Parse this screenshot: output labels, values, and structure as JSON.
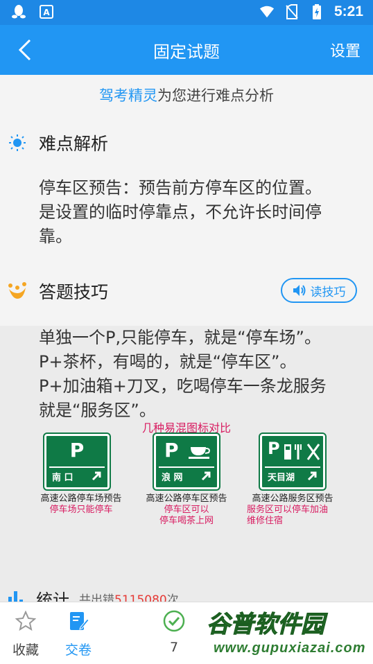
{
  "status_bar": {
    "time": "5:21"
  },
  "header": {
    "title": "固定试题",
    "settings_label": "设置"
  },
  "analysis_line": {
    "brand": "驾考精灵",
    "suffix": "为您进行难点分析"
  },
  "difficulty": {
    "title": "难点解析",
    "body": "停车区预告：预告前方停车区的位置。是设置的临时停靠点，不允许长时间停靠。"
  },
  "tips": {
    "title": "答题技巧",
    "read_button": "读技巧",
    "body": "单独一个P,只能停车，就是“停车场”。P+茶杯，有喝的，就是“停车区”。P+加油箱+刀叉，吃喝停车一条龙服务就是“服务区”。"
  },
  "signs": {
    "title": "几种易混图标对比",
    "items": [
      {
        "symbol": "P",
        "place": "南 口",
        "caption": "高速公路停车场预告",
        "note": "停车场只能停车"
      },
      {
        "symbol": "P",
        "place": "浪 网",
        "caption": "高速公路停车区预告",
        "note": "停车区可以\n停车喝茶上网"
      },
      {
        "symbol": "P",
        "place": "天目湖",
        "caption": "高速公路服务区预告",
        "note": "服务区可以停车加油\n维修住宿"
      }
    ]
  },
  "stats": {
    "title": "统计",
    "prefix": "共出错",
    "count": "5115080",
    "suffix": "次"
  },
  "bottom_tabs": [
    {
      "label": "收藏",
      "icon": "star-icon"
    },
    {
      "label": "交卷",
      "icon": "edit-paper-icon"
    },
    {
      "label": "7",
      "icon": "check-circle-icon"
    }
  ],
  "watermark": {
    "text": "谷普软件园",
    "url": "www.gupuxiazai.com"
  },
  "colors": {
    "primary": "#2196f3",
    "sign_green": "#0f7a46",
    "accent_red": "#d81b60"
  }
}
